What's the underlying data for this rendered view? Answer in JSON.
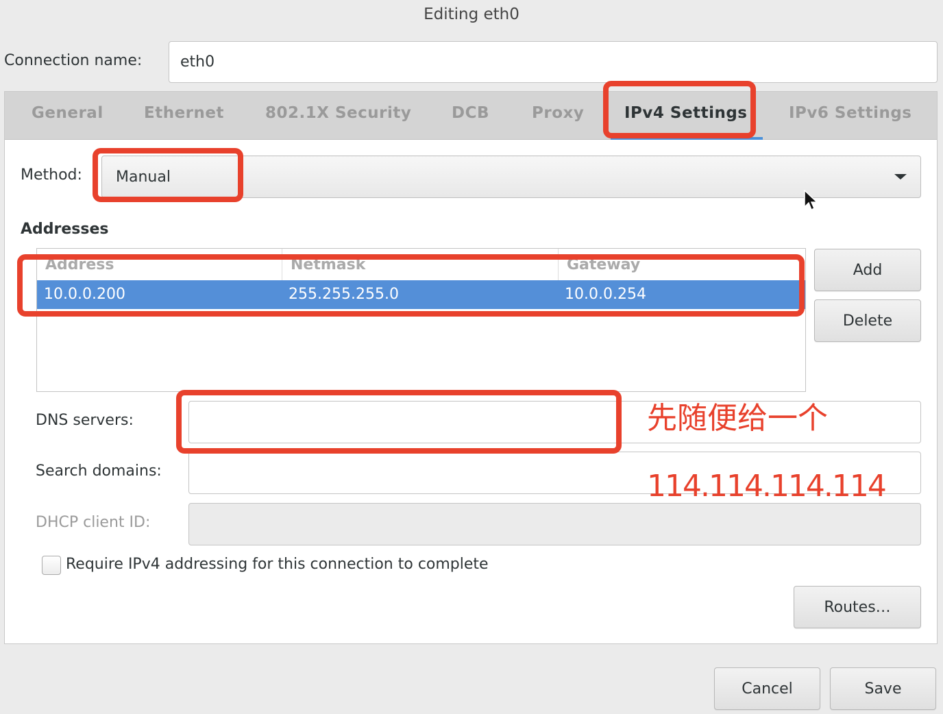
{
  "window": {
    "title": "Editing eth0"
  },
  "connection": {
    "label": "Connection name:",
    "value": "eth0"
  },
  "tabs": [
    {
      "label": "General"
    },
    {
      "label": "Ethernet"
    },
    {
      "label": "802.1X Security"
    },
    {
      "label": "DCB"
    },
    {
      "label": "Proxy"
    },
    {
      "label": "IPv4 Settings",
      "active": true
    },
    {
      "label": "IPv6 Settings"
    }
  ],
  "ipv4": {
    "method_label": "Method:",
    "method_value": "Manual",
    "addresses_heading": "Addresses",
    "columns": [
      "Address",
      "Netmask",
      "Gateway"
    ],
    "rows": [
      {
        "address": "10.0.0.200",
        "netmask": "255.255.255.0",
        "gateway": "10.0.0.254",
        "selected": true
      }
    ],
    "add_label": "Add",
    "delete_label": "Delete",
    "dns_label": "DNS servers:",
    "dns_value": "",
    "search_label": "Search domains:",
    "search_value": "",
    "dhcp_label": "DHCP client ID:",
    "dhcp_value": "",
    "require_label": "Require IPv4 addressing for this connection to complete",
    "require_checked": false,
    "routes_label": "Routes…"
  },
  "footer": {
    "cancel_label": "Cancel",
    "save_label": "Save"
  },
  "annotations": {
    "note": "先随便给一个",
    "dns_hint": "114.114.114.114",
    "color": "#e8412c"
  },
  "colors": {
    "selection": "#548fd8",
    "tab_underline": "#4a90d9"
  }
}
